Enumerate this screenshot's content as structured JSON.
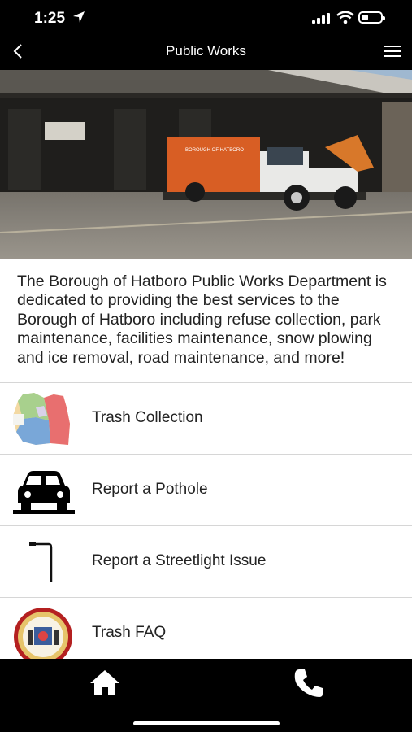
{
  "status_bar": {
    "time": "1:25"
  },
  "navbar": {
    "title": "Public Works"
  },
  "hero": {
    "truck_text": "BOROUGH OF HATBORO"
  },
  "intro": {
    "text": "The Borough of Hatboro Public Works Department is dedicated to providing the best services to the Borough of Hatboro including refuse collection, park maintenance, facilities maintenance, snow plowing and ice removal, road maintenance, and more!"
  },
  "items": [
    {
      "label": "Trash Collection",
      "icon": "map-icon"
    },
    {
      "label": "Report a Pothole",
      "icon": "car-icon"
    },
    {
      "label": "Report a Streetlight Issue",
      "icon": "streetlight-icon"
    },
    {
      "label": "Trash FAQ",
      "icon": "seal-icon"
    }
  ],
  "tabbar": {
    "items": [
      "home-icon",
      "phone-icon"
    ]
  }
}
